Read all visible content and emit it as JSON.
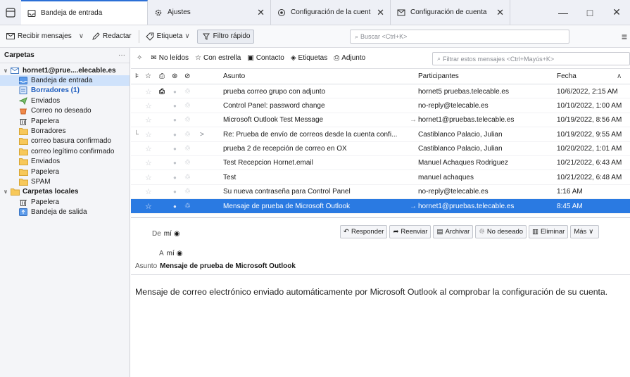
{
  "tabs": [
    {
      "label": "Bandeja de entrada",
      "icon": "inbox-icon",
      "active": true,
      "closable": false
    },
    {
      "label": "Ajustes",
      "icon": "gear-icon",
      "active": false,
      "closable": true
    },
    {
      "label": "Configuración de la cuent",
      "icon": "account-settings-icon",
      "active": false,
      "closable": true
    },
    {
      "label": "Configuración de cuenta",
      "icon": "account-icon",
      "active": false,
      "closable": true
    }
  ],
  "window_controls": {
    "minimize": "—",
    "maximize": "□",
    "close": "✕"
  },
  "toolbar": {
    "get_messages": "Recibir mensajes",
    "compose": "Redactar",
    "tag": "Etiqueta",
    "quick_filter": "Filtro rápido",
    "search_placeholder": "Buscar <Ctrl+K>"
  },
  "folder_pane": {
    "title": "Carpetas",
    "more": "···",
    "items": [
      {
        "label": "hornet1@prue....elecable.es",
        "icon": "account-icon",
        "level": 0,
        "twisty": "∨",
        "style": "bold"
      },
      {
        "label": "Bandeja de entrada",
        "icon": "inbox-icon",
        "level": 1,
        "style": "selected"
      },
      {
        "label": "Borradores (1)",
        "icon": "drafts-icon",
        "level": 1,
        "style": "unread"
      },
      {
        "label": "Enviados",
        "icon": "sent-icon",
        "level": 1,
        "style": ""
      },
      {
        "label": "Correo no deseado",
        "icon": "junk-icon",
        "level": 1,
        "style": ""
      },
      {
        "label": "Papelera",
        "icon": "trash-icon",
        "level": 1,
        "style": ""
      },
      {
        "label": "Borradores",
        "icon": "folder-icon",
        "level": 1,
        "style": ""
      },
      {
        "label": "correo basura confirmado",
        "icon": "folder-icon",
        "level": 1,
        "style": ""
      },
      {
        "label": "correo legítimo confirmado",
        "icon": "folder-icon",
        "level": 1,
        "style": ""
      },
      {
        "label": "Enviados",
        "icon": "folder-icon",
        "level": 1,
        "style": ""
      },
      {
        "label": "Papelera",
        "icon": "folder-icon",
        "level": 1,
        "style": ""
      },
      {
        "label": "SPAM",
        "icon": "folder-icon",
        "level": 1,
        "style": ""
      },
      {
        "label": "Carpetas locales",
        "icon": "folder-icon",
        "level": 0,
        "twisty": "∨",
        "style": "bold"
      },
      {
        "label": "Papelera",
        "icon": "trash-icon",
        "level": 1,
        "style": ""
      },
      {
        "label": "Bandeja de salida",
        "icon": "outbox-icon",
        "level": 1,
        "style": ""
      }
    ]
  },
  "quick_filter_bar": {
    "unread": "No leídos",
    "starred": "Con estrella",
    "contact": "Contacto",
    "tags": "Etiquetas",
    "attachment": "Adjunto",
    "filter_placeholder": "Filtrar estos mensajes <Ctrl+Mayús+K>"
  },
  "columns": {
    "subject": "Asunto",
    "participants": "Participantes",
    "date": "Fecha"
  },
  "messages": [
    {
      "subject": "prueba correo grupo con adjunto",
      "participants": "hornet5 pruebas.telecable.es",
      "date": "10/6/2022, 2:15 AM",
      "attachment": true,
      "arrow": "",
      "thread_child": false,
      "sent": false,
      "selected": false
    },
    {
      "subject": "Control Panel: password change",
      "participants": "no-reply@telecable.es",
      "date": "10/10/2022, 1:00 AM",
      "attachment": false,
      "arrow": "",
      "thread_child": false,
      "sent": false,
      "selected": false
    },
    {
      "subject": "Microsoft Outlook Test Message",
      "participants": "hornet1@pruebas.telecable.es",
      "date": "10/19/2022, 8:56 AM",
      "attachment": false,
      "arrow": "",
      "thread_child": false,
      "sent": true,
      "selected": false
    },
    {
      "subject": "Re: Prueba de envío de correos desde la cuenta confi...",
      "participants": "Castiblanco Palacio, Julian",
      "date": "10/19/2022, 9:55 AM",
      "attachment": false,
      "arrow": ">",
      "thread_child": true,
      "sent": false,
      "selected": false
    },
    {
      "subject": "prueba 2 de recepción de correo en OX",
      "participants": "Castiblanco Palacio, Julian",
      "date": "10/20/2022, 1:01 AM",
      "attachment": false,
      "arrow": "",
      "thread_child": false,
      "sent": false,
      "selected": false
    },
    {
      "subject": "Test Recepcion Hornet.email",
      "participants": "Manuel Achaques Rodriguez",
      "date": "10/21/2022, 6:43 AM",
      "attachment": false,
      "arrow": "",
      "thread_child": false,
      "sent": false,
      "selected": false
    },
    {
      "subject": "Test",
      "participants": "manuel achaques",
      "date": "10/21/2022, 6:48 AM",
      "attachment": false,
      "arrow": "",
      "thread_child": false,
      "sent": false,
      "selected": false
    },
    {
      "subject": "Su nueva contraseña para Control Panel",
      "participants": "no-reply@telecable.es",
      "date": "1:16 AM",
      "attachment": false,
      "arrow": "",
      "thread_child": false,
      "sent": false,
      "selected": false
    },
    {
      "subject": "Mensaje de prueba de Microsoft Outlook",
      "participants": "hornet1@pruebas.telecable.es",
      "date": "8:45 AM",
      "attachment": false,
      "arrow": "",
      "thread_child": false,
      "sent": true,
      "selected": true
    }
  ],
  "message_header": {
    "from_label": "De",
    "from_value": "mí",
    "to_label": "A",
    "to_value": "mí",
    "subject_label": "Asunto",
    "subject_value": "Mensaje de prueba de Microsoft Outlook",
    "actions": [
      {
        "label": "Responder",
        "icon": "reply-icon"
      },
      {
        "label": "Reenviar",
        "icon": "forward-icon"
      },
      {
        "label": "Archivar",
        "icon": "archive-icon"
      },
      {
        "label": "No deseado",
        "icon": "junk-icon"
      },
      {
        "label": "Eliminar",
        "icon": "trash-icon"
      },
      {
        "label": "Más",
        "icon": "chevron-down-icon"
      }
    ]
  },
  "message_body": "Mensaje de correo electrónico enviado automáticamente por Microsoft Outlook al comprobar la configuración de su cuenta.",
  "colors": {
    "accent": "#2a7ae2",
    "selection_light": "#cfe2fb",
    "unread_folder": "#1d5dbf"
  }
}
